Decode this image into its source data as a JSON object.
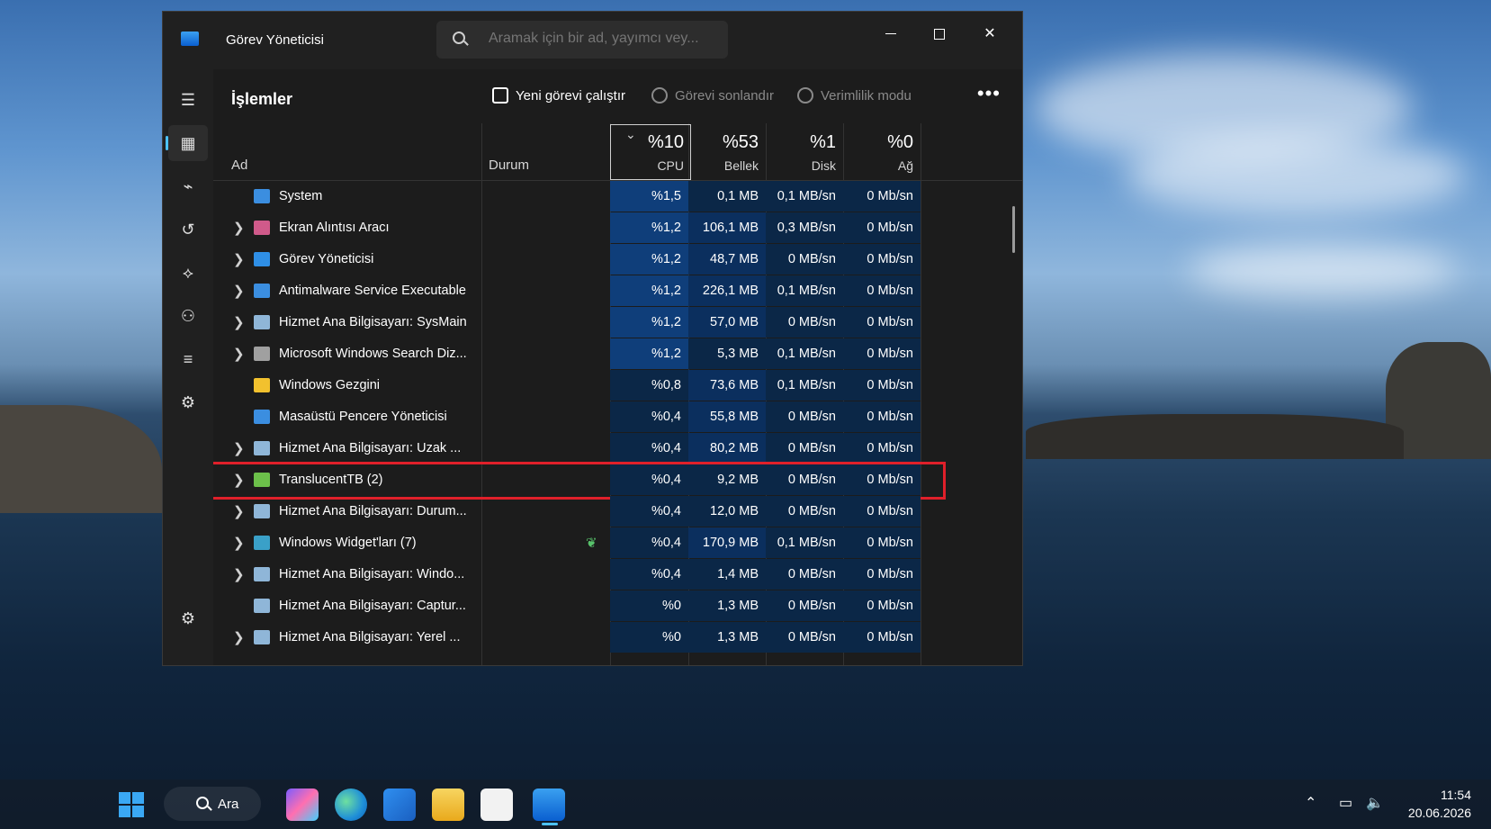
{
  "app": {
    "title": "Görev Yöneticisi",
    "search_placeholder": "Aramak için bir ad, yayımcı vey..."
  },
  "window_controls": {
    "minimize": "minimize-icon",
    "maximize": "maximize-icon",
    "close": "✕"
  },
  "nav": [
    "menu-icon",
    "processes-icon",
    "performance-icon",
    "app-history-icon",
    "startup-icon",
    "users-icon",
    "details-icon",
    "services-icon",
    "settings-icon"
  ],
  "toolbar": {
    "page_title": "İşlemler",
    "run_new_task": "Yeni görevi çalıştır",
    "end_task": "Görevi sonlandır",
    "efficiency_mode": "Verimlilik modu",
    "more": "•••"
  },
  "columns": {
    "name": "Ad",
    "status": "Durum",
    "cpu": {
      "pct": "%10",
      "label": "CPU"
    },
    "memory": {
      "pct": "%53",
      "label": "Bellek"
    },
    "disk": {
      "pct": "%1",
      "label": "Disk"
    },
    "network": {
      "pct": "%0",
      "label": "Ağ"
    }
  },
  "processes": [
    {
      "name": "System",
      "expand": "",
      "cpu": "%1,5",
      "mem": "0,1 MB",
      "disk": "0,1 MB/sn",
      "net": "0 Mb/sn",
      "icon_color": "#3b8ee0"
    },
    {
      "name": "Ekran Alıntısı Aracı",
      "expand": "❯",
      "cpu": "%1,2",
      "mem": "106,1 MB",
      "disk": "0,3 MB/sn",
      "net": "0 Mb/sn",
      "icon_color": "#d05a8a"
    },
    {
      "name": "Görev Yöneticisi",
      "expand": "❯",
      "cpu": "%1,2",
      "mem": "48,7 MB",
      "disk": "0 MB/sn",
      "net": "0 Mb/sn",
      "icon_color": "#2f8fe6"
    },
    {
      "name": "Antimalware Service Executable",
      "expand": "❯",
      "cpu": "%1,2",
      "mem": "226,1 MB",
      "disk": "0,1 MB/sn",
      "net": "0 Mb/sn",
      "icon_color": "#3b8ee0"
    },
    {
      "name": "Hizmet Ana Bilgisayarı: SysMain",
      "expand": "❯",
      "cpu": "%1,2",
      "mem": "57,0 MB",
      "disk": "0 MB/sn",
      "net": "0 Mb/sn",
      "icon_color": "#8fb6d8"
    },
    {
      "name": "Microsoft Windows Search Diz...",
      "expand": "❯",
      "cpu": "%1,2",
      "mem": "5,3 MB",
      "disk": "0,1 MB/sn",
      "net": "0 Mb/sn",
      "icon_color": "#a0a0a0"
    },
    {
      "name": "Windows Gezgini",
      "expand": "",
      "cpu": "%0,8",
      "mem": "73,6 MB",
      "disk": "0,1 MB/sn",
      "net": "0 Mb/sn",
      "icon_color": "#f2c12e"
    },
    {
      "name": "Masaüstü Pencere Yöneticisi",
      "expand": "",
      "cpu": "%0,4",
      "mem": "55,8 MB",
      "disk": "0 MB/sn",
      "net": "0 Mb/sn",
      "icon_color": "#3b8ee0"
    },
    {
      "name": "Hizmet Ana Bilgisayarı: Uzak ...",
      "expand": "❯",
      "cpu": "%0,4",
      "mem": "80,2 MB",
      "disk": "0 MB/sn",
      "net": "0 Mb/sn",
      "icon_color": "#8fb6d8"
    },
    {
      "name": "TranslucentTB (2)",
      "expand": "❯",
      "cpu": "%0,4",
      "mem": "9,2 MB",
      "disk": "0 MB/sn",
      "net": "0 Mb/sn",
      "icon_color": "#6cc04a"
    },
    {
      "name": "Hizmet Ana Bilgisayarı: Durum...",
      "expand": "❯",
      "cpu": "%0,4",
      "mem": "12,0 MB",
      "disk": "0 MB/sn",
      "net": "0 Mb/sn",
      "icon_color": "#8fb6d8"
    },
    {
      "name": "Windows Widget'ları (7)",
      "expand": "❯",
      "cpu": "%0,4",
      "mem": "170,9 MB",
      "disk": "0,1 MB/sn",
      "net": "0 Mb/sn",
      "icon_color": "#3aa0c8"
    },
    {
      "name": "Hizmet Ana Bilgisayarı: Windo...",
      "expand": "❯",
      "cpu": "%0,4",
      "mem": "1,4 MB",
      "disk": "0 MB/sn",
      "net": "0 Mb/sn",
      "icon_color": "#8fb6d8"
    },
    {
      "name": "Hizmet Ana Bilgisayarı: Captur...",
      "expand": "",
      "cpu": "%0",
      "mem": "1,3 MB",
      "disk": "0 MB/sn",
      "net": "0 Mb/sn",
      "icon_color": "#8fb6d8"
    },
    {
      "name": "Hizmet Ana Bilgisayarı: Yerel ...",
      "expand": "❯",
      "cpu": "%0",
      "mem": "1,3 MB",
      "disk": "0 MB/sn",
      "net": "0 Mb/sn",
      "icon_color": "#8fb6d8"
    }
  ],
  "highlighted_process": "TranslucentTB (2)",
  "taskbar": {
    "search_label": "Ara",
    "clock_time": "11:54",
    "clock_date": "20.06.2026",
    "apps": [
      "copilot-icon",
      "edge-icon",
      "outlook-icon",
      "file-explorer-icon",
      "store-icon",
      "task-manager-icon"
    ]
  },
  "colors": {
    "accent": "#4cc2ff",
    "highlight_border": "#e0202a",
    "cpu_heat": "#0f3e7a",
    "mem_heat": "#0b2f5e"
  }
}
